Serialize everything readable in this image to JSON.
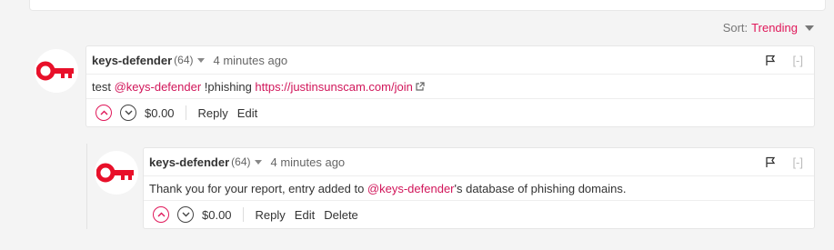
{
  "sort": {
    "label": "Sort:",
    "value": "Trending"
  },
  "comments": [
    {
      "author": "keys-defender",
      "reputation": "(64)",
      "time": "4 minutes ago",
      "collapse_label": "[-]",
      "body_parts": {
        "prefix": "test ",
        "mention": "@keys-defender",
        "middle": " !phishing ",
        "url": "https://justinsunscam.com/join"
      },
      "payout": "$0.00",
      "actions": [
        "Reply",
        "Edit"
      ]
    },
    {
      "author": "keys-defender",
      "reputation": "(64)",
      "time": "4 minutes ago",
      "collapse_label": "[-]",
      "body_parts": {
        "prefix": "Thank you for your report, entry added to ",
        "mention": "@keys-defender",
        "middle": "'s database of phishing domains."
      },
      "payout": "$0.00",
      "actions": [
        "Reply",
        "Edit",
        "Delete"
      ]
    }
  ],
  "colors": {
    "accent": "#e0185a",
    "avatar_key": "#e8102a"
  },
  "icons": [
    "key-avatar-icon",
    "flag-icon",
    "upvote-icon",
    "downvote-icon",
    "external-link-icon",
    "caret-down-icon"
  ]
}
